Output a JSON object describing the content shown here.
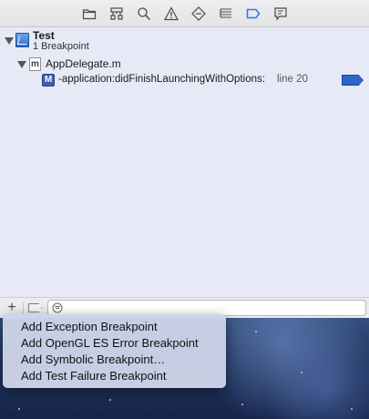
{
  "tree": {
    "project": {
      "name": "Test",
      "subtitle": "1 Breakpoint"
    },
    "file": {
      "name": "AppDelegate.m",
      "icon_letter": "m"
    },
    "breakpoint": {
      "icon_letter": "M",
      "symbol": "-application:didFinishLaunchingWithOptions:",
      "location": "line 20"
    }
  },
  "toolbar_icons": [
    "folder-icon",
    "hierarchy-icon",
    "search-icon",
    "warning-icon",
    "test-diamond-icon",
    "debug-list-icon",
    "breakpoint-navigator-icon",
    "log-icon"
  ],
  "filter": {
    "add_label": "+",
    "placeholder": ""
  },
  "menu": {
    "items": [
      "Add Exception Breakpoint",
      "Add OpenGL ES Error Breakpoint",
      "Add Symbolic Breakpoint…",
      "Add Test Failure Breakpoint"
    ]
  },
  "colors": {
    "accent": "#2f64c8",
    "navigator_bg": "#e7eaf6",
    "menu_bg": "#ced4e8"
  }
}
